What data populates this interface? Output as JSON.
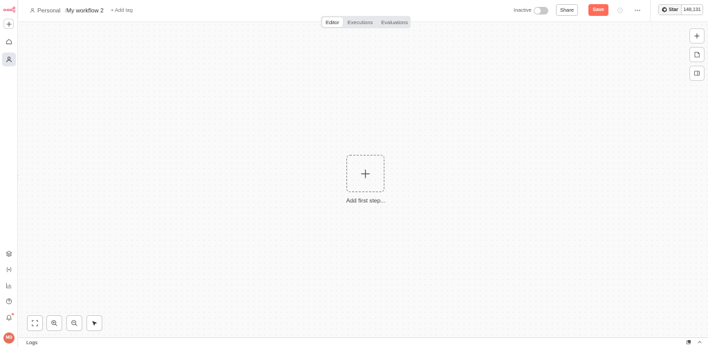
{
  "header": {
    "breadcrumb_project": "Personal",
    "breadcrumb_separator": "/",
    "workflow_name": "My workflow 2",
    "add_tag": "+ Add tag",
    "status_label": "Inactive",
    "share_label": "Share",
    "save_label": "Save",
    "github_star": "Star",
    "github_count": "148,131"
  },
  "tabs": [
    {
      "label": "Editor",
      "active": true
    },
    {
      "label": "Executions",
      "active": false
    },
    {
      "label": "Evaluations",
      "active": false
    }
  ],
  "canvas": {
    "add_first_step": "Add first step..."
  },
  "sidebar": {
    "avatar_initials": "MD"
  },
  "logs": {
    "label": "Logs"
  },
  "colors": {
    "accent": "#ff6d5a",
    "active_nav": "#e4e6ee"
  }
}
